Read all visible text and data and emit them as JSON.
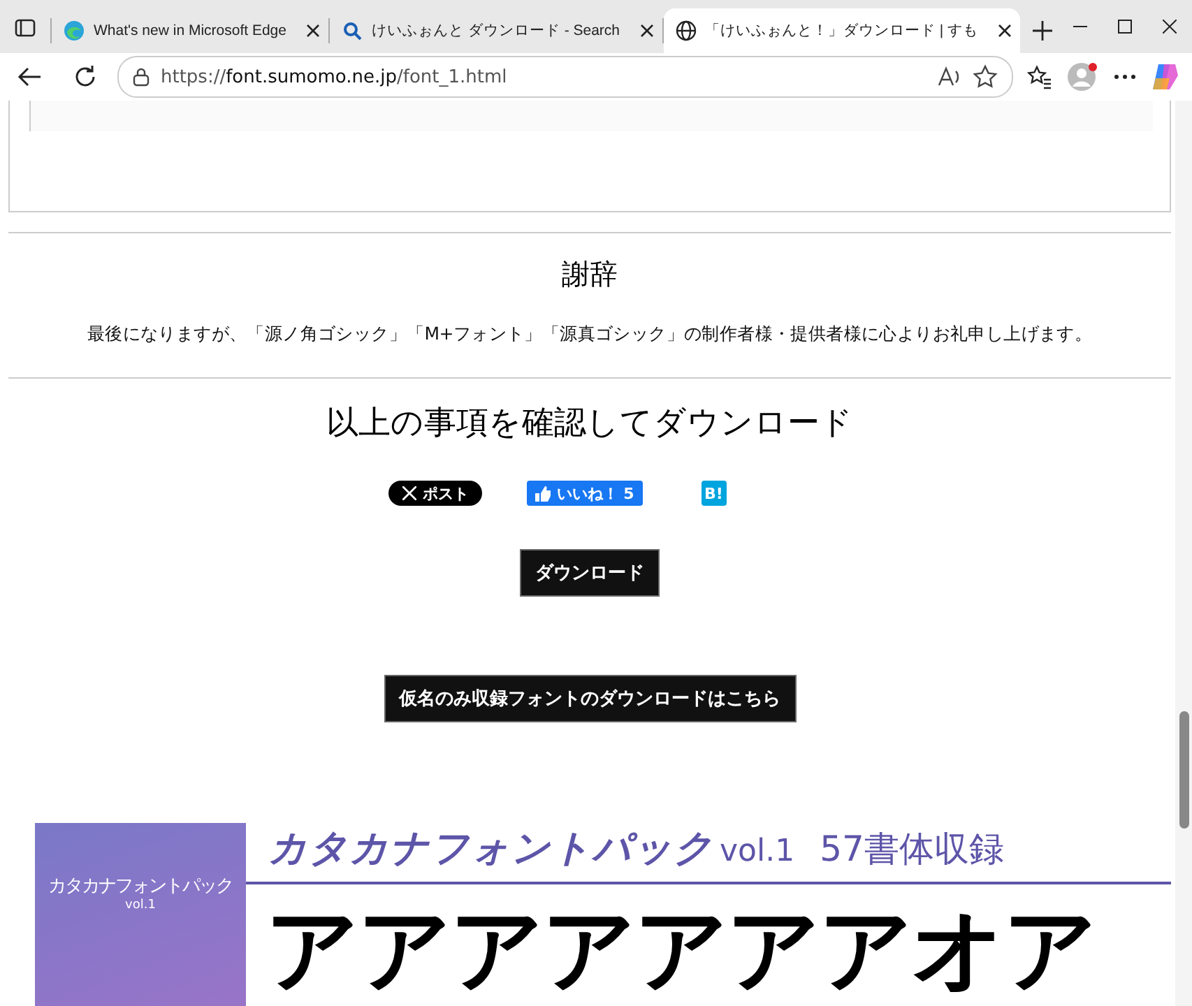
{
  "browser": {
    "tabs": [
      {
        "title": "What's new in Microsoft Edge",
        "selected": false
      },
      {
        "title": "けいふぉんと ダウンロード - Search",
        "selected": false
      },
      {
        "title": "「けいふぉんと！」ダウンロード | すも",
        "selected": true
      }
    ],
    "address": {
      "scheme": "https://",
      "host": "font.sumomo.ne.jp",
      "path": "/font_1.html"
    }
  },
  "page": {
    "acknowledgements": {
      "heading": "謝辞",
      "text": "最後になりますが、「源ノ角ゴシック」「M+フォント」「源真ゴシック」の制作者様・提供者様に心よりお礼申し上げます。"
    },
    "download_section": {
      "heading": "以上の事項を確認してダウンロード",
      "share": [
        {
          "kind": "x",
          "label": "ポスト"
        },
        {
          "kind": "like",
          "label": "いいね！",
          "count": "5"
        },
        {
          "kind": "hatena",
          "label": "B!"
        }
      ],
      "buttons": [
        "ダウンロード",
        "仮名のみ収録フォントのダウンロードはこちら"
      ]
    },
    "banner": {
      "cover_title": "カタカナフォントパック",
      "cover_subtitle": "vol.1",
      "title": "カタカナフォントパック",
      "title_suffix": "vol.1",
      "count": "57書体収録",
      "sample": "アアアアアアアオア"
    }
  }
}
